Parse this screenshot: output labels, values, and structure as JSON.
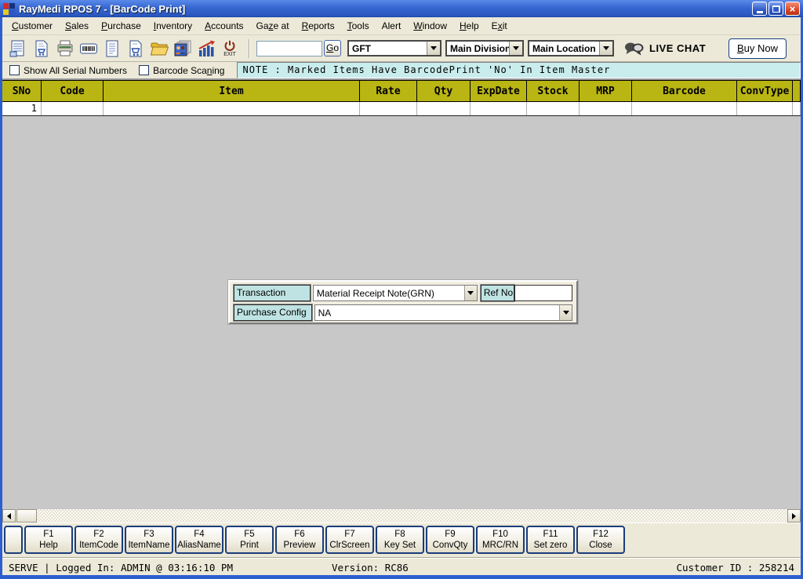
{
  "window": {
    "title": "RayMedi RPOS 7 - [BarCode Print]"
  },
  "menu": {
    "items": [
      {
        "label": "Customer",
        "u": 0
      },
      {
        "label": "Sales",
        "u": 0
      },
      {
        "label": "Purchase",
        "u": 0
      },
      {
        "label": "Inventory",
        "u": 0
      },
      {
        "label": "Accounts",
        "u": 0
      },
      {
        "label": "Gaze at",
        "u": 2
      },
      {
        "label": "Reports",
        "u": 0
      },
      {
        "label": "Tools",
        "u": 0
      },
      {
        "label": "Alert"
      },
      {
        "label": "Window",
        "u": 0
      },
      {
        "label": "Help",
        "u": 0
      },
      {
        "label": "Exit",
        "u": 1
      }
    ]
  },
  "toolbar": {
    "icons": [
      "invoice-icon",
      "sales-cart-icon",
      "printer-icon",
      "barcode-icon",
      "document-icon",
      "purchase-cart-icon",
      "folder-icon",
      "customers-icon",
      "chart-icon",
      "exit-icon"
    ],
    "exit_label": "EXIT",
    "search_value": "",
    "go": {
      "label": "Go",
      "u": 0
    },
    "company_select": "GFT",
    "division_select": "Main Division",
    "location_select": "Main Location",
    "live_chat_label": "LIVE CHAT",
    "buy_now": {
      "label": "Buy Now",
      "u": 0
    }
  },
  "options": {
    "show_serials": {
      "label": "Show All Serial Numbers",
      "checked": false
    },
    "barcode_scanning": {
      "label": "Barcode Scaning",
      "u": 11,
      "checked": false
    },
    "note": "NOTE :  Marked Items Have BarcodePrint 'No' In Item Master"
  },
  "table": {
    "columns": [
      "SNo",
      "Code",
      "Item",
      "Rate",
      "Qty",
      "ExpDate",
      "Stock",
      "MRP",
      "Barcode",
      "ConvType"
    ],
    "rows": [
      {
        "sno": "1",
        "code": "",
        "item": "",
        "rate": "",
        "qty": "",
        "expdate": "",
        "stock": "",
        "mrp": "",
        "barcode": "",
        "convtype": ""
      }
    ]
  },
  "dialog": {
    "transaction_label": "Transaction",
    "transaction_value": "Material Receipt Note(GRN)",
    "ref_no_label": "Ref No",
    "ref_no_value": "",
    "purchase_config_label": "Purchase Config",
    "purchase_config_value": "NA"
  },
  "function_keys": [
    {
      "key": "F1",
      "label": "Help"
    },
    {
      "key": "F2",
      "label": "ItemCode"
    },
    {
      "key": "F3",
      "label": "ItemName"
    },
    {
      "key": "F4",
      "label": "AliasName"
    },
    {
      "key": "F5",
      "label": "Print"
    },
    {
      "key": "F6",
      "label": "Preview"
    },
    {
      "key": "F7",
      "label": "ClrScreen"
    },
    {
      "key": "F8",
      "label": "Key Set"
    },
    {
      "key": "F9",
      "label": "ConvQty"
    },
    {
      "key": "F10",
      "label": "MRC/RN"
    },
    {
      "key": "F11",
      "label": "Set zero"
    },
    {
      "key": "F12",
      "label": "Close"
    }
  ],
  "status_bar": {
    "left": "SERVE |  Logged In: ADMIN  @ 03:16:10 PM",
    "version": "Version: RC86",
    "customer_id": "Customer ID : 258214"
  },
  "colors": {
    "titlebar_blue": "#3766d2",
    "toolbar_beige": "#ece9d8",
    "grid_header_olive": "#b9b513",
    "note_cyan": "#c9ecec",
    "label_cyan": "#bfe3e3",
    "workspace_gray": "#c8c8c8",
    "close_red": "#d84828"
  }
}
